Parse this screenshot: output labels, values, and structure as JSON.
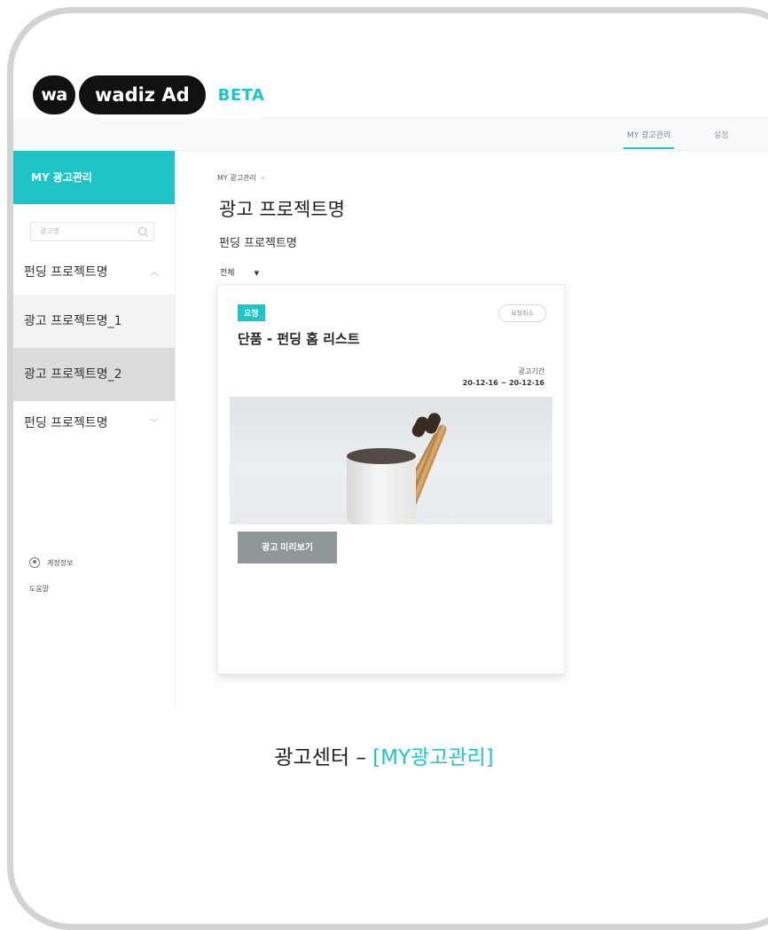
{
  "logo": {
    "mark": "wa",
    "name": "wadiz Ad",
    "beta": "BETA"
  },
  "topnav": {
    "active": "MY 광고관리",
    "settings": "설정"
  },
  "sidebar": {
    "header": "MY 광고관리",
    "search_placeholder": "광고명",
    "funding_1": "펀딩 프로젝트명",
    "ad_1": "광고 프로젝트명_1",
    "ad_2": "광고 프로젝트명_2",
    "funding_2": "펀딩 프로젝트명",
    "account": "계정정보",
    "help": "도움말"
  },
  "main": {
    "breadcrumb": "MY 광고관리",
    "breadcrumb_sep": ">",
    "title": "광고 프로젝트명",
    "subtitle": "펀딩 프로젝트명",
    "filter": "전체",
    "filter_caret": "▼"
  },
  "card": {
    "badge": "요청",
    "cancel": "요청취소",
    "title": "단품 - 펀딩 홈 리스트",
    "period_label": "광고기간",
    "period_value": "20-12-16 ~ 20-12-16",
    "preview": "광고 미리보기"
  },
  "caption": {
    "text": "광고센터 – ",
    "highlight": "[MY광고관리]"
  },
  "colors": {
    "accent": "#1fc3c8",
    "button_gray": "#8f9799"
  }
}
